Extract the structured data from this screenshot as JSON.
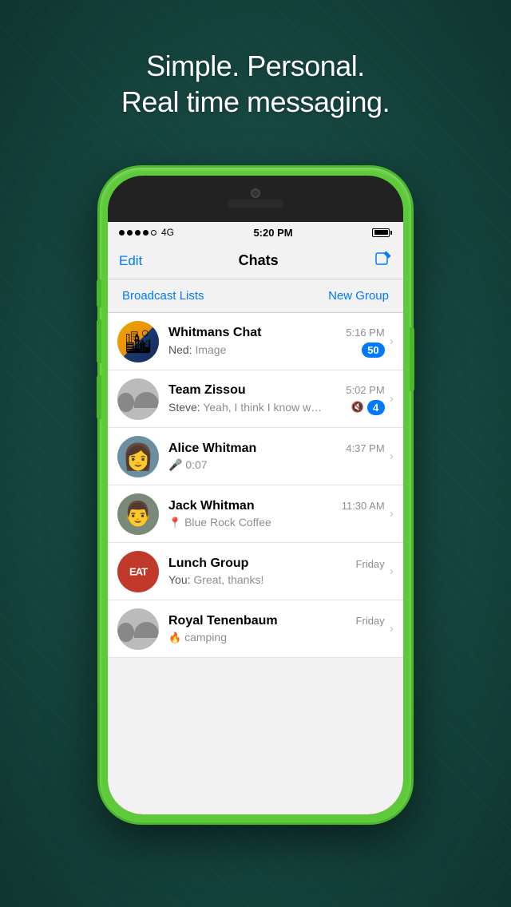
{
  "background": {
    "tagline_line1": "Simple. Personal.",
    "tagline_line2": "Real time messaging."
  },
  "status_bar": {
    "signal": "●●●●○ 4G",
    "time": "5:20 PM",
    "battery": "full"
  },
  "nav": {
    "edit_label": "Edit",
    "title": "Chats",
    "compose_icon": "✏"
  },
  "actions": {
    "broadcast_label": "Broadcast Lists",
    "new_group_label": "New Group"
  },
  "chats": [
    {
      "name": "Whitmans Chat",
      "time": "5:16 PM",
      "sender": "Ned:",
      "preview": "Image",
      "badge": "50",
      "muted": false,
      "avatar_type": "whitmans"
    },
    {
      "name": "Team Zissou",
      "time": "5:02 PM",
      "sender": "Steve:",
      "preview": "Yeah, I think I know wha...",
      "badge": "4",
      "muted": true,
      "avatar_type": "gray"
    },
    {
      "name": "Alice Whitman",
      "time": "4:37 PM",
      "sender": "",
      "preview": "0:07",
      "badge": "",
      "muted": false,
      "has_mic": true,
      "avatar_type": "alice"
    },
    {
      "name": "Jack Whitman",
      "time": "11:30 AM",
      "sender": "",
      "preview": "Blue Rock Coffee",
      "badge": "",
      "muted": false,
      "has_location": true,
      "avatar_type": "jack"
    },
    {
      "name": "Lunch Group",
      "time": "Friday",
      "sender": "You:",
      "preview": "Great, thanks!",
      "badge": "",
      "muted": false,
      "avatar_type": "lunch"
    },
    {
      "name": "Royal Tenenbaum",
      "time": "Friday",
      "sender": "",
      "preview": "camping",
      "badge": "",
      "muted": false,
      "has_fire": true,
      "avatar_type": "royal"
    }
  ]
}
